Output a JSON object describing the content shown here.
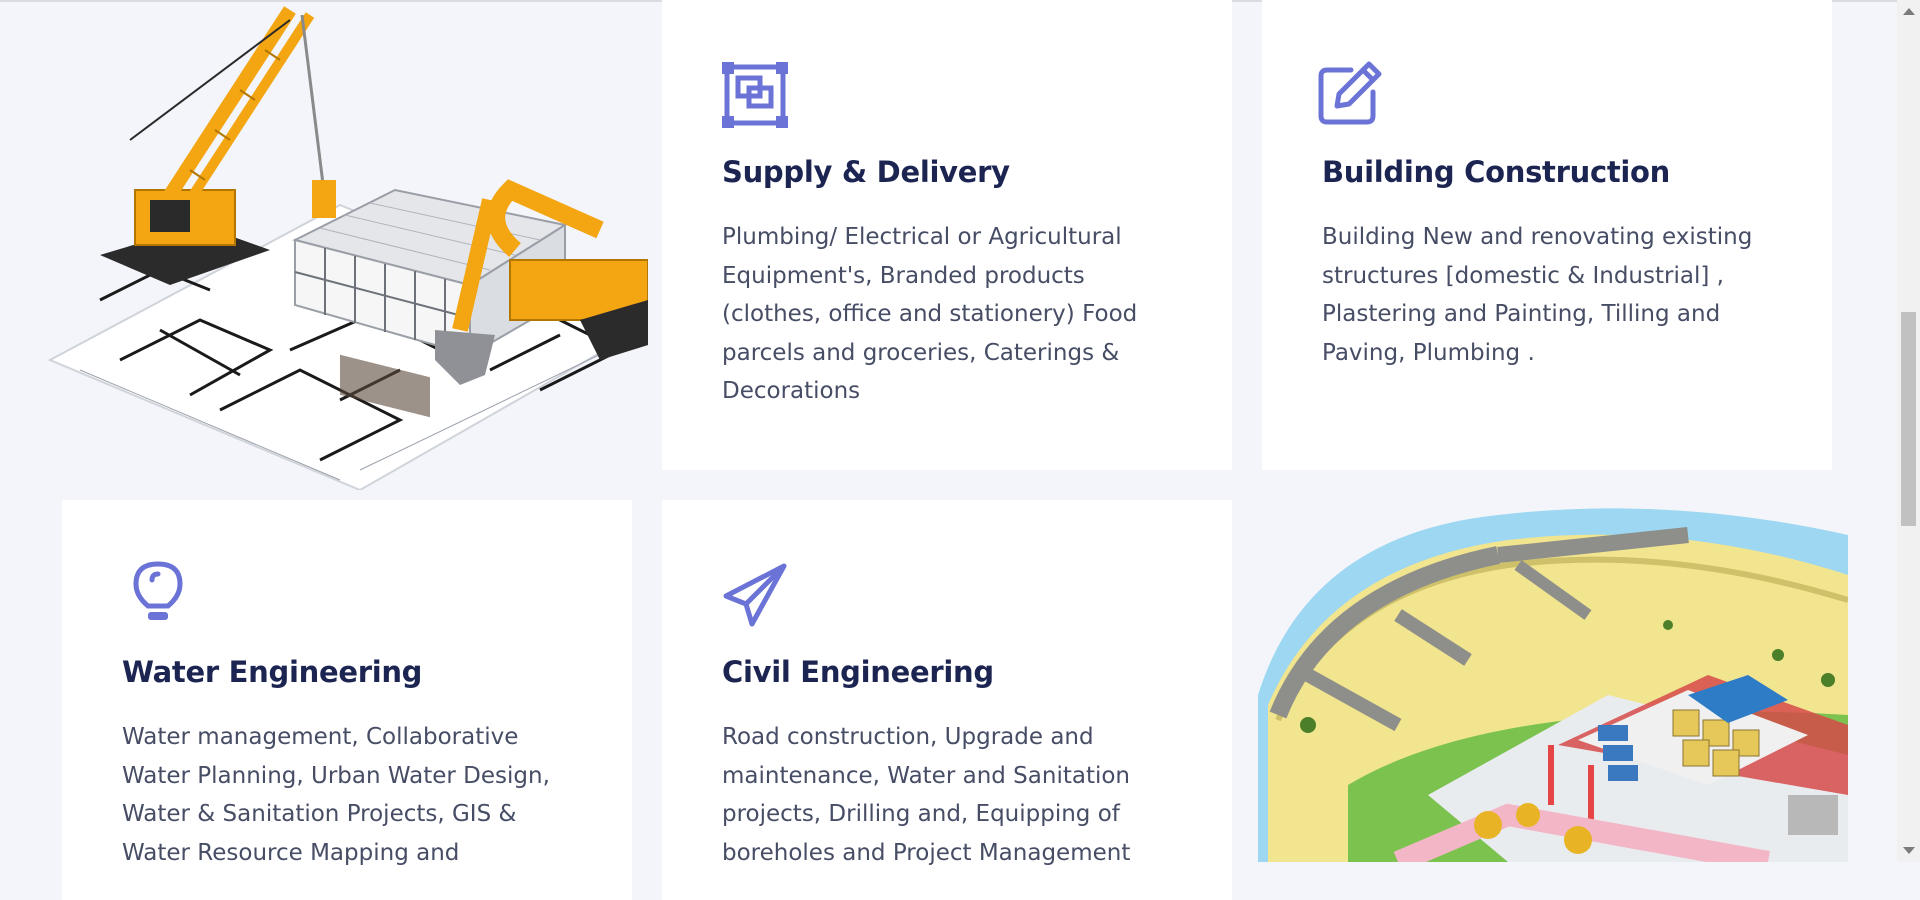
{
  "colors": {
    "accent": "#6b74d6",
    "heading": "#1c2551",
    "body_text": "#464d65",
    "background": "#f3f5fa",
    "card": "#ffffff"
  },
  "services": [
    {
      "title": "Supply & Delivery",
      "icon": "layers-icon",
      "description": "Plumbing/ Electrical or Agricultural Equipment's, Branded products (clothes, office and stationery) Food parcels and groceries, Caterings & Decorations"
    },
    {
      "title": "Building Construction",
      "icon": "edit-icon",
      "description": "Building New and renovating existing structures [domestic & Industrial] , Plastering and Painting, Tilling and Paving, Plumbing ."
    },
    {
      "title": "Water Engineering",
      "icon": "lightbulb-icon",
      "description": "Water management, Collaborative Water Planning, Urban Water Design, Water & Sanitation Projects, GIS & Water Resource Mapping and"
    },
    {
      "title": "Civil Engineering",
      "icon": "paper-plane-icon",
      "description": "Road construction, Upgrade and maintenance, Water and Sanitation projects, Drilling and, Equipping of boreholes and Project Management"
    }
  ],
  "images": {
    "construction": "construction-cranes-illustration",
    "site": "isometric-building-site-illustration"
  }
}
